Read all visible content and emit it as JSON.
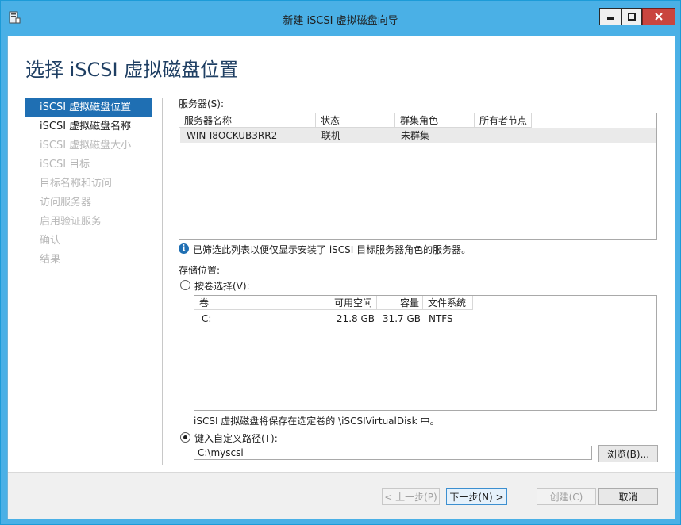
{
  "window": {
    "title": "新建 iSCSI 虚拟磁盘向导",
    "minimize_glyph": "▁",
    "maximize_glyph": "□",
    "close_glyph": "✕"
  },
  "page": {
    "heading": "选择 iSCSI 虚拟磁盘位置"
  },
  "nav": {
    "items": [
      {
        "label": "iSCSI 虚拟磁盘位置",
        "state": "active"
      },
      {
        "label": "iSCSI 虚拟磁盘名称",
        "state": "done"
      },
      {
        "label": "iSCSI 虚拟磁盘大小",
        "state": "disabled"
      },
      {
        "label": "iSCSI 目标",
        "state": "disabled"
      },
      {
        "label": "目标名称和访问",
        "state": "disabled"
      },
      {
        "label": "访问服务器",
        "state": "disabled"
      },
      {
        "label": "启用验证服务",
        "state": "disabled"
      },
      {
        "label": "确认",
        "state": "disabled"
      },
      {
        "label": "结果",
        "state": "disabled"
      }
    ]
  },
  "servers": {
    "label": "服务器(S):",
    "columns": [
      "服务器名称",
      "状态",
      "群集角色",
      "所有者节点"
    ],
    "rows": [
      [
        "WIN-I8OCKUB3RR2",
        "联机",
        "未群集",
        ""
      ]
    ],
    "info_text": "已筛选此列表以便仅显示安装了 iSCSI 目标服务器角色的服务器。",
    "info_icon_glyph": "i"
  },
  "storage": {
    "label": "存储位置:",
    "by_volume_label": "按卷选择(V):",
    "by_volume_selected": false,
    "volume_columns": [
      "卷",
      "可用空间",
      "容量",
      "文件系统"
    ],
    "volume_rows": [
      [
        "C:",
        "21.8 GB",
        "31.7 GB",
        "NTFS"
      ]
    ],
    "save_note": "iSCSI 虚拟磁盘将保存在选定卷的 \\iSCSIVirtualDisk 中。",
    "custom_path_label": "键入自定义路径(T):",
    "custom_path_selected": true,
    "custom_path_value": "C:\\myscsi",
    "browse_label": "浏览(B)..."
  },
  "footer": {
    "prev_label": "< 上一步(P)",
    "next_label": "下一步(N) >",
    "create_label": "创建(C)",
    "cancel_label": "取消"
  },
  "colors": {
    "titlebar": "#4ab0e6",
    "heading": "#1f3f63",
    "nav_active": "#1f6fb3",
    "close_button": "#c9453f"
  }
}
